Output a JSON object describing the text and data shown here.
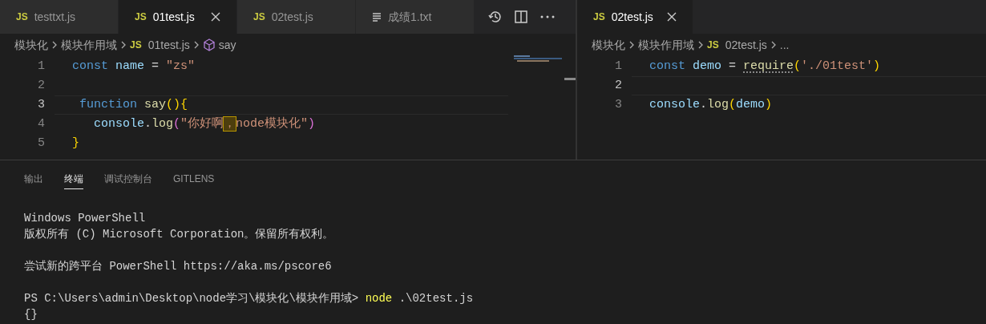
{
  "left_editor": {
    "tabs": [
      {
        "icon": "JS",
        "label": "testtxt.js",
        "selected": false,
        "close": false
      },
      {
        "icon": "JS",
        "label": "01test.js",
        "selected": true,
        "close": true
      },
      {
        "icon": "JS",
        "label": "02test.js",
        "selected": false,
        "close": false
      },
      {
        "label": "成绩1.txt",
        "selected": false,
        "close": false
      }
    ],
    "breadcrumb": [
      {
        "kind": "folder",
        "text": "模块化"
      },
      {
        "kind": "folder",
        "text": "模块作用域"
      },
      {
        "kind": "file",
        "icon": "JS",
        "text": "01test.js"
      },
      {
        "kind": "symbol",
        "text": "say"
      }
    ],
    "lines": [
      {
        "number": "1",
        "current": false,
        "tokens": [
          {
            "kind": "keyword",
            "text": "const "
          },
          {
            "kind": "variable",
            "text": "name"
          },
          {
            "kind": "plain",
            "text": " = "
          },
          {
            "kind": "string",
            "text": "\"zs\""
          }
        ]
      },
      {
        "number": "2",
        "current": false
      },
      {
        "number": "3",
        "current": true,
        "tokens": [
          {
            "kind": "keyword",
            "text": " function "
          },
          {
            "kind": "function",
            "text": "say"
          },
          {
            "kind": "bracket",
            "text": "(){"
          }
        ]
      },
      {
        "number": "4",
        "current": false,
        "tokens": [
          {
            "kind": "variable",
            "text": "   console"
          },
          {
            "kind": "plain",
            "text": "."
          },
          {
            "kind": "function",
            "text": "log"
          },
          {
            "kind": "bracket2",
            "text": "("
          },
          {
            "kind": "string",
            "text": "\"你好啊"
          },
          {
            "kind": "flagged",
            "text": "，"
          },
          {
            "kind": "string",
            "text": "node模块化\""
          },
          {
            "kind": "bracket2",
            "text": ")"
          }
        ]
      },
      {
        "number": "5",
        "current": false,
        "tokens": [
          {
            "kind": "bracket",
            "text": "}"
          }
        ]
      }
    ]
  },
  "right_editor": {
    "tabs": [
      {
        "icon": "JS",
        "label": "02test.js",
        "selected": true,
        "close": true
      }
    ],
    "breadcrumb": [
      {
        "kind": "folder",
        "text": "模块化"
      },
      {
        "kind": "folder",
        "text": "模块作用域"
      },
      {
        "kind": "file",
        "icon": "JS",
        "text": "02test.js"
      },
      {
        "kind": "symbol",
        "text": "..."
      }
    ],
    "lines": [
      {
        "number": "1",
        "current": false,
        "tokens": [
          {
            "kind": "keyword",
            "text": "const "
          },
          {
            "kind": "variable",
            "text": "demo"
          },
          {
            "kind": "plain",
            "text": " = "
          },
          {
            "kind": "hinted",
            "text": "require"
          },
          {
            "kind": "bracket",
            "text": "("
          },
          {
            "kind": "string",
            "text": "'./01test'"
          },
          {
            "kind": "bracket",
            "text": ")"
          }
        ]
      },
      {
        "number": "2",
        "current": true
      },
      {
        "number": "3",
        "current": false,
        "tokens": [
          {
            "kind": "variable",
            "text": "console"
          },
          {
            "kind": "plain",
            "text": "."
          },
          {
            "kind": "function",
            "text": "log"
          },
          {
            "kind": "bracket",
            "text": "("
          },
          {
            "kind": "variable",
            "text": "demo"
          },
          {
            "kind": "bracket",
            "text": ")"
          }
        ]
      }
    ]
  },
  "panel": {
    "tabs": [
      {
        "label": "输出",
        "selected": false
      },
      {
        "label": "终端",
        "selected": true
      },
      {
        "label": "调试控制台",
        "selected": false
      },
      {
        "label": "GITLENS",
        "selected": false
      }
    ],
    "terminal_blocks": [
      [
        [
          {
            "kind": "plain",
            "text": "Windows PowerShell"
          }
        ],
        [
          {
            "kind": "plain",
            "text": "版权所有 (C) Microsoft Corporation。保留所有权利。"
          }
        ]
      ],
      [
        [
          {
            "kind": "plain",
            "text": "尝试新的跨平台 PowerShell https://aka.ms/pscore6"
          }
        ]
      ],
      [
        [
          {
            "kind": "plain",
            "text": "PS C:\\Users\\admin\\Desktop\\node学习\\模块化\\模块作用域> "
          },
          {
            "kind": "command",
            "text": "node"
          },
          {
            "kind": "plain",
            "text": " .\\02test.js"
          }
        ],
        [
          {
            "kind": "plain",
            "text": "{}"
          }
        ]
      ]
    ]
  }
}
